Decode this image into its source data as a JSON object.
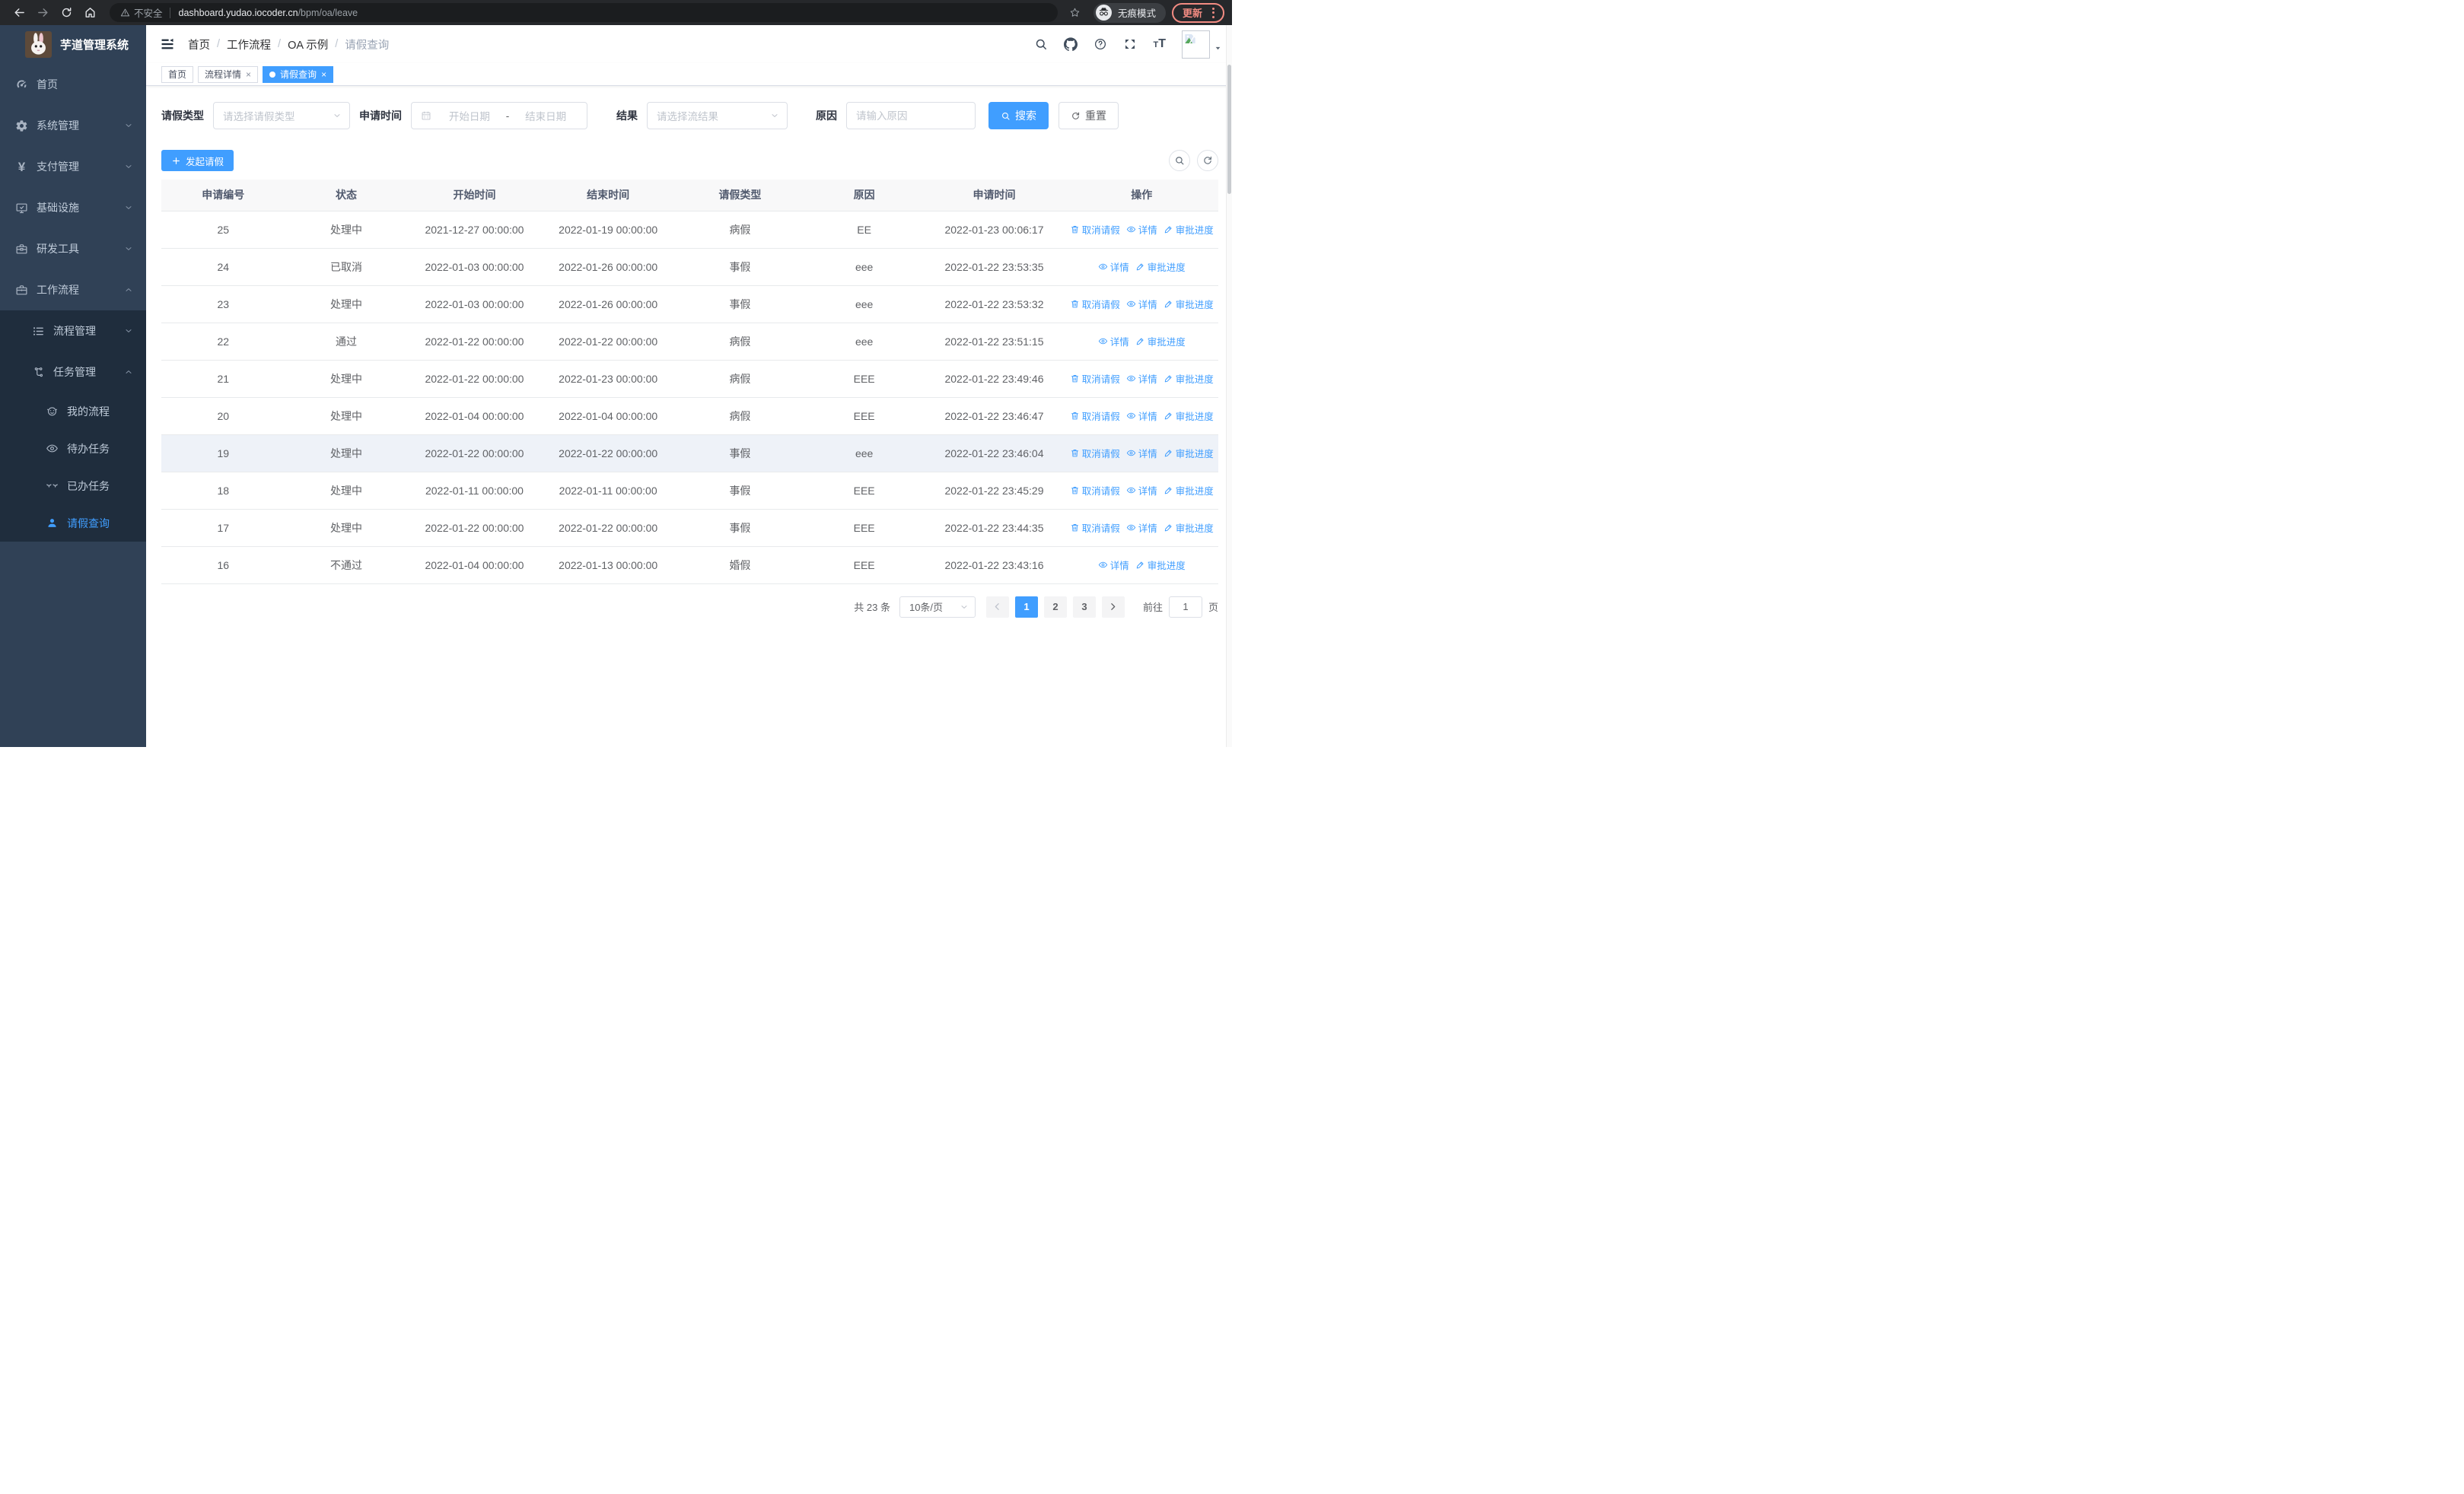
{
  "browser": {
    "security_warning": "不安全",
    "url_host": "dashboard.yudao.iocoder.cn",
    "url_path": "/bpm/oa/leave",
    "incognito_label": "无痕模式",
    "update_label": "更新"
  },
  "sidebar": {
    "title": "芋道管理系统",
    "items": [
      {
        "key": "home",
        "label": "首页",
        "icon": "dashboard-icon",
        "level": 1
      },
      {
        "key": "system",
        "label": "系统管理",
        "icon": "gear-icon",
        "level": 1,
        "chevron": "down"
      },
      {
        "key": "pay",
        "label": "支付管理",
        "icon": "yen-icon",
        "level": 1,
        "chevron": "down"
      },
      {
        "key": "infra",
        "label": "基础设施",
        "icon": "monitor-icon",
        "level": 1,
        "chevron": "down"
      },
      {
        "key": "dev-tools",
        "label": "研发工具",
        "icon": "toolbox-icon",
        "level": 1,
        "chevron": "down"
      },
      {
        "key": "workflow",
        "label": "工作流程",
        "icon": "briefcase-icon",
        "level": 1,
        "chevron": "up"
      },
      {
        "key": "process-mgmt",
        "label": "流程管理",
        "icon": "list-icon",
        "level": 2,
        "chevron": "down"
      },
      {
        "key": "task-mgmt",
        "label": "任务管理",
        "icon": "flow-icon",
        "level": 2,
        "chevron": "up"
      },
      {
        "key": "my-process",
        "label": "我的流程",
        "icon": "robot-icon",
        "level": 3
      },
      {
        "key": "todo-tasks",
        "label": "待办任务",
        "icon": "eye-icon",
        "level": 3
      },
      {
        "key": "done-tasks",
        "label": "已办任务",
        "icon": "eye-closed-icon",
        "level": 3
      },
      {
        "key": "leave-query",
        "label": "请假查询",
        "icon": "user-icon",
        "level": 3,
        "active": true
      }
    ]
  },
  "navbar": {
    "breadcrumb": [
      "首页",
      "工作流程",
      "OA 示例",
      "请假查询"
    ],
    "breadcrumb_separator": "/"
  },
  "tags": [
    {
      "key": "home",
      "label": "首页",
      "closable": false,
      "active": false
    },
    {
      "key": "process-detail",
      "label": "流程详情",
      "closable": true,
      "active": false
    },
    {
      "key": "leave-query",
      "label": "请假查询",
      "closable": true,
      "active": true
    }
  ],
  "filters": {
    "leave_type_label": "请假类型",
    "leave_type_placeholder": "请选择请假类型",
    "apply_time_label": "申请时间",
    "date_start_placeholder": "开始日期",
    "date_separator": "-",
    "date_end_placeholder": "结束日期",
    "result_label": "结果",
    "result_placeholder": "请选择流结果",
    "reason_label": "原因",
    "reason_placeholder": "请输入原因",
    "search_label": "搜索",
    "reset_label": "重置"
  },
  "toolbar": {
    "create_label": "发起请假"
  },
  "table": {
    "columns": [
      "申请编号",
      "状态",
      "开始时间",
      "结束时间",
      "请假类型",
      "原因",
      "申请时间",
      "操作"
    ],
    "action_labels": {
      "cancel": "取消请假",
      "detail": "详情",
      "progress": "审批进度"
    },
    "rows": [
      {
        "id": "25",
        "status": "处理中",
        "start": "2021-12-27 00:00:00",
        "end": "2022-01-19 00:00:00",
        "type": "病假",
        "reason": "EE",
        "applied": "2022-01-23 00:06:17",
        "cancellable": true,
        "highlighted": false
      },
      {
        "id": "24",
        "status": "已取消",
        "start": "2022-01-03 00:00:00",
        "end": "2022-01-26 00:00:00",
        "type": "事假",
        "reason": "eee",
        "applied": "2022-01-22 23:53:35",
        "cancellable": false,
        "highlighted": false
      },
      {
        "id": "23",
        "status": "处理中",
        "start": "2022-01-03 00:00:00",
        "end": "2022-01-26 00:00:00",
        "type": "事假",
        "reason": "eee",
        "applied": "2022-01-22 23:53:32",
        "cancellable": true,
        "highlighted": false
      },
      {
        "id": "22",
        "status": "通过",
        "start": "2022-01-22 00:00:00",
        "end": "2022-01-22 00:00:00",
        "type": "病假",
        "reason": "eee",
        "applied": "2022-01-22 23:51:15",
        "cancellable": false,
        "highlighted": false
      },
      {
        "id": "21",
        "status": "处理中",
        "start": "2022-01-22 00:00:00",
        "end": "2022-01-23 00:00:00",
        "type": "病假",
        "reason": "EEE",
        "applied": "2022-01-22 23:49:46",
        "cancellable": true,
        "highlighted": false
      },
      {
        "id": "20",
        "status": "处理中",
        "start": "2022-01-04 00:00:00",
        "end": "2022-01-04 00:00:00",
        "type": "病假",
        "reason": "EEE",
        "applied": "2022-01-22 23:46:47",
        "cancellable": true,
        "highlighted": false
      },
      {
        "id": "19",
        "status": "处理中",
        "start": "2022-01-22 00:00:00",
        "end": "2022-01-22 00:00:00",
        "type": "事假",
        "reason": "eee",
        "applied": "2022-01-22 23:46:04",
        "cancellable": true,
        "highlighted": true
      },
      {
        "id": "18",
        "status": "处理中",
        "start": "2022-01-11 00:00:00",
        "end": "2022-01-11 00:00:00",
        "type": "事假",
        "reason": "EEE",
        "applied": "2022-01-22 23:45:29",
        "cancellable": true,
        "highlighted": false
      },
      {
        "id": "17",
        "status": "处理中",
        "start": "2022-01-22 00:00:00",
        "end": "2022-01-22 00:00:00",
        "type": "事假",
        "reason": "EEE",
        "applied": "2022-01-22 23:44:35",
        "cancellable": true,
        "highlighted": false
      },
      {
        "id": "16",
        "status": "不通过",
        "start": "2022-01-04 00:00:00",
        "end": "2022-01-13 00:00:00",
        "type": "婚假",
        "reason": "EEE",
        "applied": "2022-01-22 23:43:16",
        "cancellable": false,
        "highlighted": false
      }
    ]
  },
  "pagination": {
    "total_text": "共 23 条",
    "page_size": "10条/页",
    "pages": [
      "1",
      "2",
      "3"
    ],
    "active_page": "1",
    "goto_label": "前往",
    "goto_value": "1",
    "goto_suffix": "页"
  },
  "colors": {
    "accent": "#409eff",
    "sidebar_bg": "#304156",
    "sidebar_submenu_bg": "#1f2d3d",
    "sidebar_text": "#bfcbd9",
    "table_header_bg": "#f8f8f9",
    "row_hover_bg": "#eef2f8",
    "update_chip": "#f28b82"
  }
}
